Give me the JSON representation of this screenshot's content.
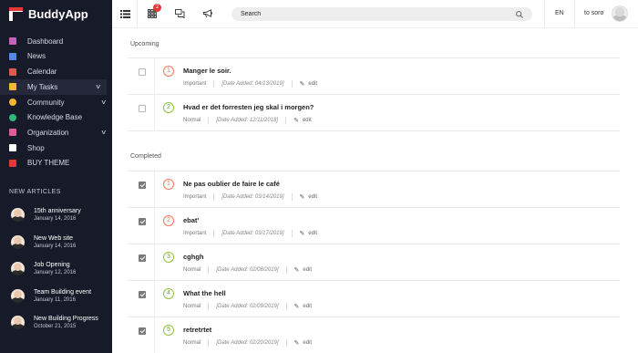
{
  "brand": {
    "name": "BuddyApp"
  },
  "sidebar": {
    "items": [
      {
        "label": "Dashboard",
        "icon": "dashboard-icon",
        "color": "#c762b8",
        "caret": false
      },
      {
        "label": "News",
        "icon": "news-icon",
        "color": "#4f8ae8",
        "caret": false
      },
      {
        "label": "Calendar",
        "icon": "calendar-icon",
        "color": "#e2574c",
        "caret": false
      },
      {
        "label": "My Tasks",
        "icon": "tasks-icon",
        "color": "#f5b731",
        "caret": true,
        "active": true
      },
      {
        "label": "Community",
        "icon": "community-icon",
        "color": "#f5b731",
        "caret": true
      },
      {
        "label": "Knowledge Base",
        "icon": "knowledge-base-icon",
        "color": "#30b77a",
        "caret": false
      },
      {
        "label": "Organization",
        "icon": "organization-icon",
        "color": "#e25c98",
        "caret": true
      },
      {
        "label": "Shop",
        "icon": "shop-icon",
        "color": "#ffffff",
        "caret": false
      },
      {
        "label": "BUY THEME",
        "icon": "cart-icon",
        "color": "#e53935",
        "caret": false
      }
    ],
    "articles_title": "NEW ARTICLES",
    "articles": [
      {
        "title": "15th anniversary",
        "date": "January 14, 2016"
      },
      {
        "title": "New Web site",
        "date": "January 14, 2016"
      },
      {
        "title": "Job Opening",
        "date": "January 12, 2016"
      },
      {
        "title": "Team Building event",
        "date": "January 11, 2016"
      },
      {
        "title": "New Building Progress",
        "date": "October 21, 2015"
      }
    ]
  },
  "topbar": {
    "badge_count": "2",
    "search_placeholder": "Search",
    "language": "EN",
    "user_name": "to soro"
  },
  "tasks": {
    "upcoming_title": "Upcoming",
    "completed_title": "Completed",
    "edit_label": "edit",
    "upcoming": [
      {
        "num": "1",
        "title": "Manger le soir.",
        "priority": "Important",
        "date": "[Date Added: 04/13/2019]",
        "done": false
      },
      {
        "num": "2",
        "title": "Hvad er det forresten jeg skal i morgen?",
        "priority": "Normal",
        "date": "[Date Added: 12/11/2018]",
        "done": false
      }
    ],
    "completed": [
      {
        "num": "1",
        "title": "Ne pas oublier de faire le café",
        "priority": "Important",
        "date": "[Date Added: 03/14/2019]",
        "done": true
      },
      {
        "num": "2",
        "title": "ebat'",
        "priority": "Important",
        "date": "[Date Added: 03/17/2019]",
        "done": true
      },
      {
        "num": "3",
        "title": "cghgh",
        "priority": "Normal",
        "date": "[Date Added: 02/08/2019]",
        "done": true
      },
      {
        "num": "4",
        "title": "What the hell",
        "priority": "Normal",
        "date": "[Date Added: 02/09/2019]",
        "done": true
      },
      {
        "num": "5",
        "title": "retretrtet",
        "priority": "Normal",
        "date": "[Date Added: 02/20/2019]",
        "done": true
      }
    ]
  }
}
